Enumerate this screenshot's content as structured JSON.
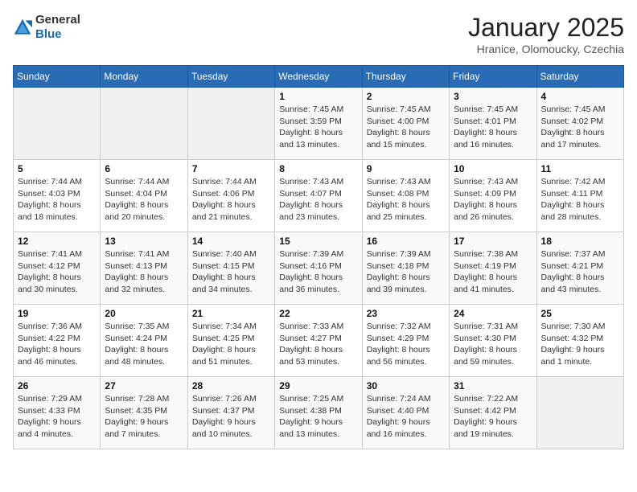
{
  "logo": {
    "general": "General",
    "blue": "Blue"
  },
  "header": {
    "month": "January 2025",
    "location": "Hranice, Olomoucky, Czechia"
  },
  "weekdays": [
    "Sunday",
    "Monday",
    "Tuesday",
    "Wednesday",
    "Thursday",
    "Friday",
    "Saturday"
  ],
  "weeks": [
    [
      {
        "day": "",
        "info": ""
      },
      {
        "day": "",
        "info": ""
      },
      {
        "day": "",
        "info": ""
      },
      {
        "day": "1",
        "info": "Sunrise: 7:45 AM\nSunset: 3:59 PM\nDaylight: 8 hours\nand 13 minutes."
      },
      {
        "day": "2",
        "info": "Sunrise: 7:45 AM\nSunset: 4:00 PM\nDaylight: 8 hours\nand 15 minutes."
      },
      {
        "day": "3",
        "info": "Sunrise: 7:45 AM\nSunset: 4:01 PM\nDaylight: 8 hours\nand 16 minutes."
      },
      {
        "day": "4",
        "info": "Sunrise: 7:45 AM\nSunset: 4:02 PM\nDaylight: 8 hours\nand 17 minutes."
      }
    ],
    [
      {
        "day": "5",
        "info": "Sunrise: 7:44 AM\nSunset: 4:03 PM\nDaylight: 8 hours\nand 18 minutes."
      },
      {
        "day": "6",
        "info": "Sunrise: 7:44 AM\nSunset: 4:04 PM\nDaylight: 8 hours\nand 20 minutes."
      },
      {
        "day": "7",
        "info": "Sunrise: 7:44 AM\nSunset: 4:06 PM\nDaylight: 8 hours\nand 21 minutes."
      },
      {
        "day": "8",
        "info": "Sunrise: 7:43 AM\nSunset: 4:07 PM\nDaylight: 8 hours\nand 23 minutes."
      },
      {
        "day": "9",
        "info": "Sunrise: 7:43 AM\nSunset: 4:08 PM\nDaylight: 8 hours\nand 25 minutes."
      },
      {
        "day": "10",
        "info": "Sunrise: 7:43 AM\nSunset: 4:09 PM\nDaylight: 8 hours\nand 26 minutes."
      },
      {
        "day": "11",
        "info": "Sunrise: 7:42 AM\nSunset: 4:11 PM\nDaylight: 8 hours\nand 28 minutes."
      }
    ],
    [
      {
        "day": "12",
        "info": "Sunrise: 7:41 AM\nSunset: 4:12 PM\nDaylight: 8 hours\nand 30 minutes."
      },
      {
        "day": "13",
        "info": "Sunrise: 7:41 AM\nSunset: 4:13 PM\nDaylight: 8 hours\nand 32 minutes."
      },
      {
        "day": "14",
        "info": "Sunrise: 7:40 AM\nSunset: 4:15 PM\nDaylight: 8 hours\nand 34 minutes."
      },
      {
        "day": "15",
        "info": "Sunrise: 7:39 AM\nSunset: 4:16 PM\nDaylight: 8 hours\nand 36 minutes."
      },
      {
        "day": "16",
        "info": "Sunrise: 7:39 AM\nSunset: 4:18 PM\nDaylight: 8 hours\nand 39 minutes."
      },
      {
        "day": "17",
        "info": "Sunrise: 7:38 AM\nSunset: 4:19 PM\nDaylight: 8 hours\nand 41 minutes."
      },
      {
        "day": "18",
        "info": "Sunrise: 7:37 AM\nSunset: 4:21 PM\nDaylight: 8 hours\nand 43 minutes."
      }
    ],
    [
      {
        "day": "19",
        "info": "Sunrise: 7:36 AM\nSunset: 4:22 PM\nDaylight: 8 hours\nand 46 minutes."
      },
      {
        "day": "20",
        "info": "Sunrise: 7:35 AM\nSunset: 4:24 PM\nDaylight: 8 hours\nand 48 minutes."
      },
      {
        "day": "21",
        "info": "Sunrise: 7:34 AM\nSunset: 4:25 PM\nDaylight: 8 hours\nand 51 minutes."
      },
      {
        "day": "22",
        "info": "Sunrise: 7:33 AM\nSunset: 4:27 PM\nDaylight: 8 hours\nand 53 minutes."
      },
      {
        "day": "23",
        "info": "Sunrise: 7:32 AM\nSunset: 4:29 PM\nDaylight: 8 hours\nand 56 minutes."
      },
      {
        "day": "24",
        "info": "Sunrise: 7:31 AM\nSunset: 4:30 PM\nDaylight: 8 hours\nand 59 minutes."
      },
      {
        "day": "25",
        "info": "Sunrise: 7:30 AM\nSunset: 4:32 PM\nDaylight: 9 hours\nand 1 minute."
      }
    ],
    [
      {
        "day": "26",
        "info": "Sunrise: 7:29 AM\nSunset: 4:33 PM\nDaylight: 9 hours\nand 4 minutes."
      },
      {
        "day": "27",
        "info": "Sunrise: 7:28 AM\nSunset: 4:35 PM\nDaylight: 9 hours\nand 7 minutes."
      },
      {
        "day": "28",
        "info": "Sunrise: 7:26 AM\nSunset: 4:37 PM\nDaylight: 9 hours\nand 10 minutes."
      },
      {
        "day": "29",
        "info": "Sunrise: 7:25 AM\nSunset: 4:38 PM\nDaylight: 9 hours\nand 13 minutes."
      },
      {
        "day": "30",
        "info": "Sunrise: 7:24 AM\nSunset: 4:40 PM\nDaylight: 9 hours\nand 16 minutes."
      },
      {
        "day": "31",
        "info": "Sunrise: 7:22 AM\nSunset: 4:42 PM\nDaylight: 9 hours\nand 19 minutes."
      },
      {
        "day": "",
        "info": ""
      }
    ]
  ]
}
